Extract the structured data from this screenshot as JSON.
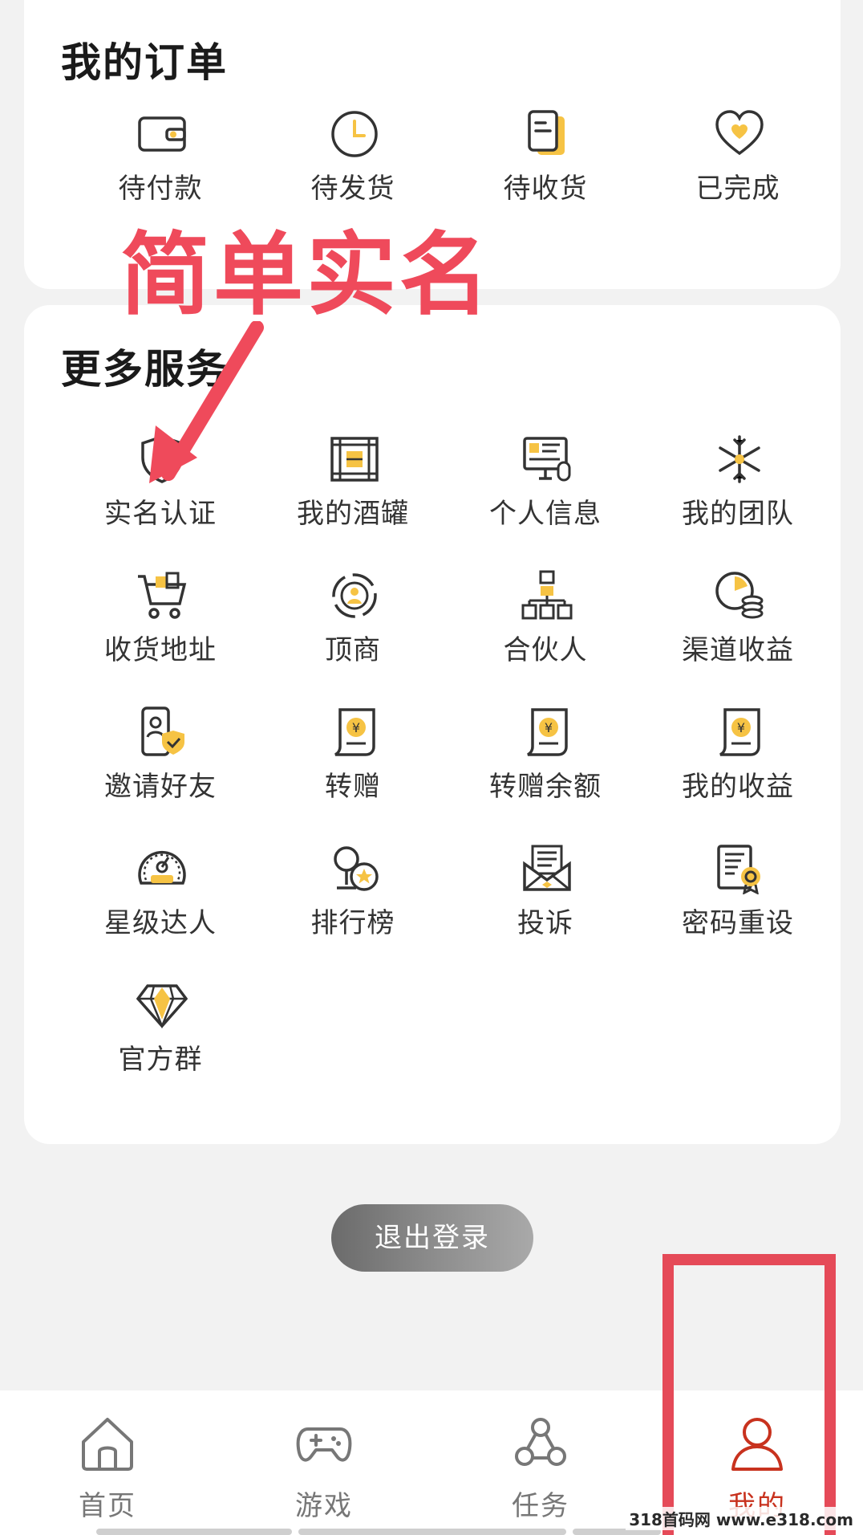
{
  "orders": {
    "title": "我的订单",
    "items": [
      {
        "label": "待付款",
        "icon": "wallet-icon"
      },
      {
        "label": "待发货",
        "icon": "clock-icon"
      },
      {
        "label": "待收货",
        "icon": "documents-icon"
      },
      {
        "label": "已完成",
        "icon": "heart-icon"
      }
    ]
  },
  "services": {
    "title": "更多服务",
    "items": [
      {
        "label": "实名认证",
        "icon": "shield-user-icon"
      },
      {
        "label": "我的酒罐",
        "icon": "wine-barrel-icon"
      },
      {
        "label": "个人信息",
        "icon": "monitor-profile-icon"
      },
      {
        "label": "我的团队",
        "icon": "snowflake-icon"
      },
      {
        "label": "收货地址",
        "icon": "shopping-cart-icon"
      },
      {
        "label": "顶商",
        "icon": "target-user-icon"
      },
      {
        "label": "合伙人",
        "icon": "org-chart-icon"
      },
      {
        "label": "渠道收益",
        "icon": "clock-coins-icon"
      },
      {
        "label": "邀请好友",
        "icon": "phone-shield-icon"
      },
      {
        "label": "转赠",
        "icon": "yuan-scroll-icon"
      },
      {
        "label": "转赠余额",
        "icon": "yuan-scroll-icon"
      },
      {
        "label": "我的收益",
        "icon": "yuan-scroll-icon"
      },
      {
        "label": "星级达人",
        "icon": "speedometer-icon"
      },
      {
        "label": "排行榜",
        "icon": "trophy-star-icon"
      },
      {
        "label": "投诉",
        "icon": "envelope-letter-icon"
      },
      {
        "label": "密码重设",
        "icon": "certificate-icon"
      },
      {
        "label": "官方群",
        "icon": "diamond-icon"
      }
    ]
  },
  "logout_label": "退出登录",
  "tabbar": {
    "tabs": [
      {
        "label": "首页",
        "icon": "home-icon"
      },
      {
        "label": "游戏",
        "icon": "gamepad-icon"
      },
      {
        "label": "任务",
        "icon": "task-circles-icon"
      },
      {
        "label": "我的",
        "icon": "user-icon",
        "active": true
      }
    ]
  },
  "annotation": {
    "text": "简单实名",
    "color": "#ef4a5b"
  },
  "watermark": "318首码网 www.e318.com",
  "colors": {
    "accent": "#f6c344",
    "active_tab": "#c8321e",
    "annotation": "#e54a58"
  }
}
